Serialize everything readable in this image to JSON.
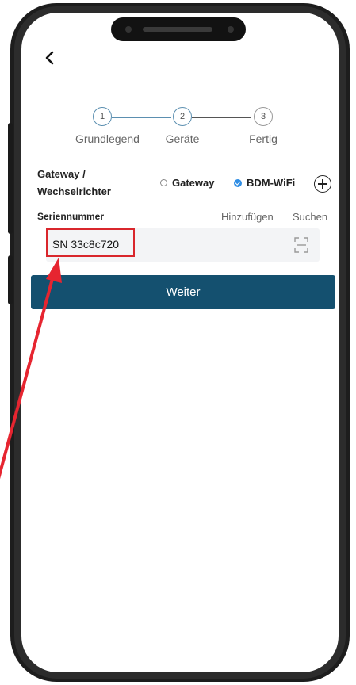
{
  "stepper": {
    "steps": [
      {
        "number": "1",
        "label": "Grundlegend"
      },
      {
        "number": "2",
        "label": "Geräte"
      },
      {
        "number": "3",
        "label": "Fertig"
      }
    ],
    "current_step": 2
  },
  "gateway": {
    "label_line1": "Gateway /",
    "label_line2": "Wechselrichter",
    "options": [
      {
        "label": "Gateway",
        "selected": false
      },
      {
        "label": "BDM-WiFi",
        "selected": true
      }
    ]
  },
  "serial": {
    "label": "Seriennummer",
    "add_link": "Hinzufügen",
    "search_link": "Suchen",
    "value": "SN 33c8c720"
  },
  "actions": {
    "next_label": "Weiter"
  },
  "colors": {
    "primary_button": "#14506f",
    "step_accent": "#5b8fb0",
    "highlight_red": "#d9262c",
    "checked_radio": "#2f8de4"
  }
}
